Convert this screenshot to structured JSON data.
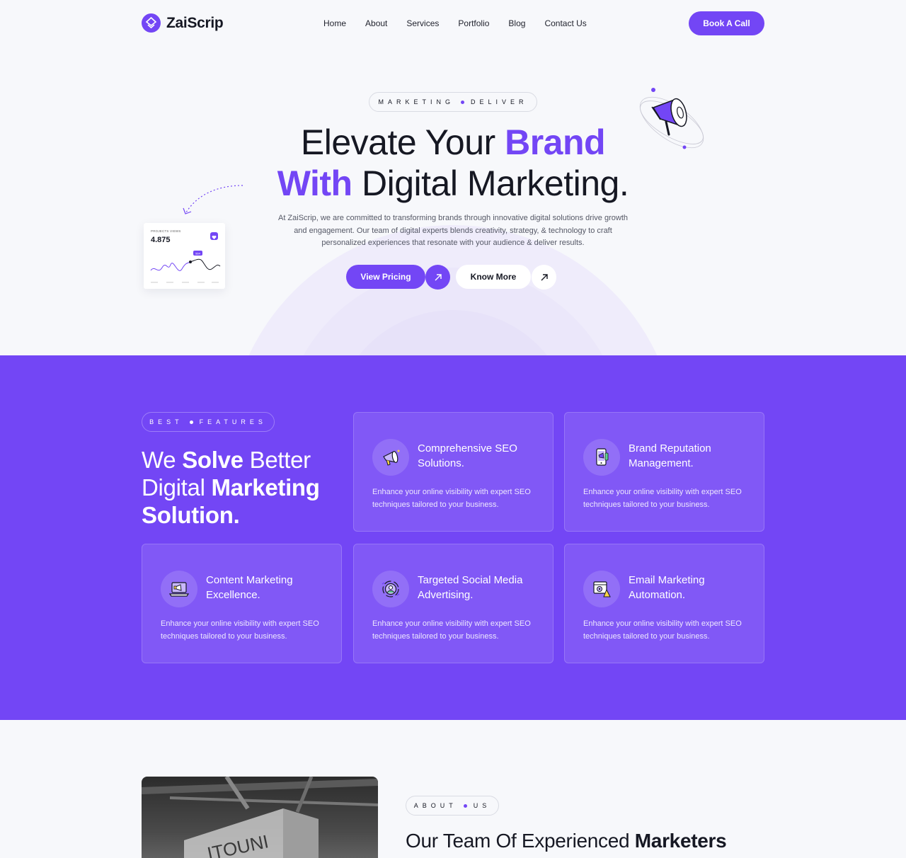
{
  "nav": {
    "logo_text": "ZaiScrip",
    "links": [
      "Home",
      "About",
      "Services",
      "Portfolio",
      "Blog",
      "Contact Us"
    ],
    "cta_label": "Book A Call"
  },
  "hero": {
    "tag_left": "MARKETING",
    "tag_right": "DELIVER",
    "title_line1_plain": "Elevate Your",
    "title_line1_accent": "Brand",
    "title_line2_accent": "With",
    "title_line2_plain": "Digital Marketing.",
    "description": "At ZaiScrip, we are committed to transforming brands through innovative digital solutions drive growth and engagement. Our team of digital experts blends creativity, strategy, & technology to craft personalized experiences that resonate with your audience & deliver results.",
    "primary_button": "View Pricing",
    "secondary_button": "Know More",
    "stat_card": {
      "label": "PROJECTS VIEWS",
      "value": "4.875",
      "chart_badge": "564"
    }
  },
  "features": {
    "tag_left": "BEST",
    "tag_right": "FEATURES",
    "heading_1": "We ",
    "heading_bold_1": "Solve",
    "heading_2": " Better Digital ",
    "heading_bold_2": "Marketing Solution.",
    "cards": [
      {
        "title": "Comprehensive SEO Solutions.",
        "desc": "Enhance your online visibility with expert SEO techniques tailored to your business.",
        "icon": "megaphone-icon"
      },
      {
        "title": "Brand Reputation Management.",
        "desc": "Enhance your online visibility with expert SEO techniques tailored to your business.",
        "icon": "phone-megaphone-icon"
      },
      {
        "title": "Content Marketing Excellence.",
        "desc": "Enhance your online visibility with expert SEO techniques tailored to your business.",
        "icon": "laptop-megaphone-icon"
      },
      {
        "title": "Targeted Social Media Advertising.",
        "desc": "Enhance your online visibility with expert SEO techniques tailored to your business.",
        "icon": "social-target-icon"
      },
      {
        "title": "Email Marketing Automation.",
        "desc": "Enhance your online visibility with expert SEO techniques tailored to your business.",
        "icon": "email-automation-icon"
      }
    ]
  },
  "about": {
    "tag_left": "ABOUT",
    "tag_right": "US",
    "heading_plain": "Our Team Of Experienced ",
    "heading_bold": "Marketers"
  },
  "colors": {
    "accent": "#7346f5",
    "text": "#161823",
    "background": "#f7f8fb"
  }
}
